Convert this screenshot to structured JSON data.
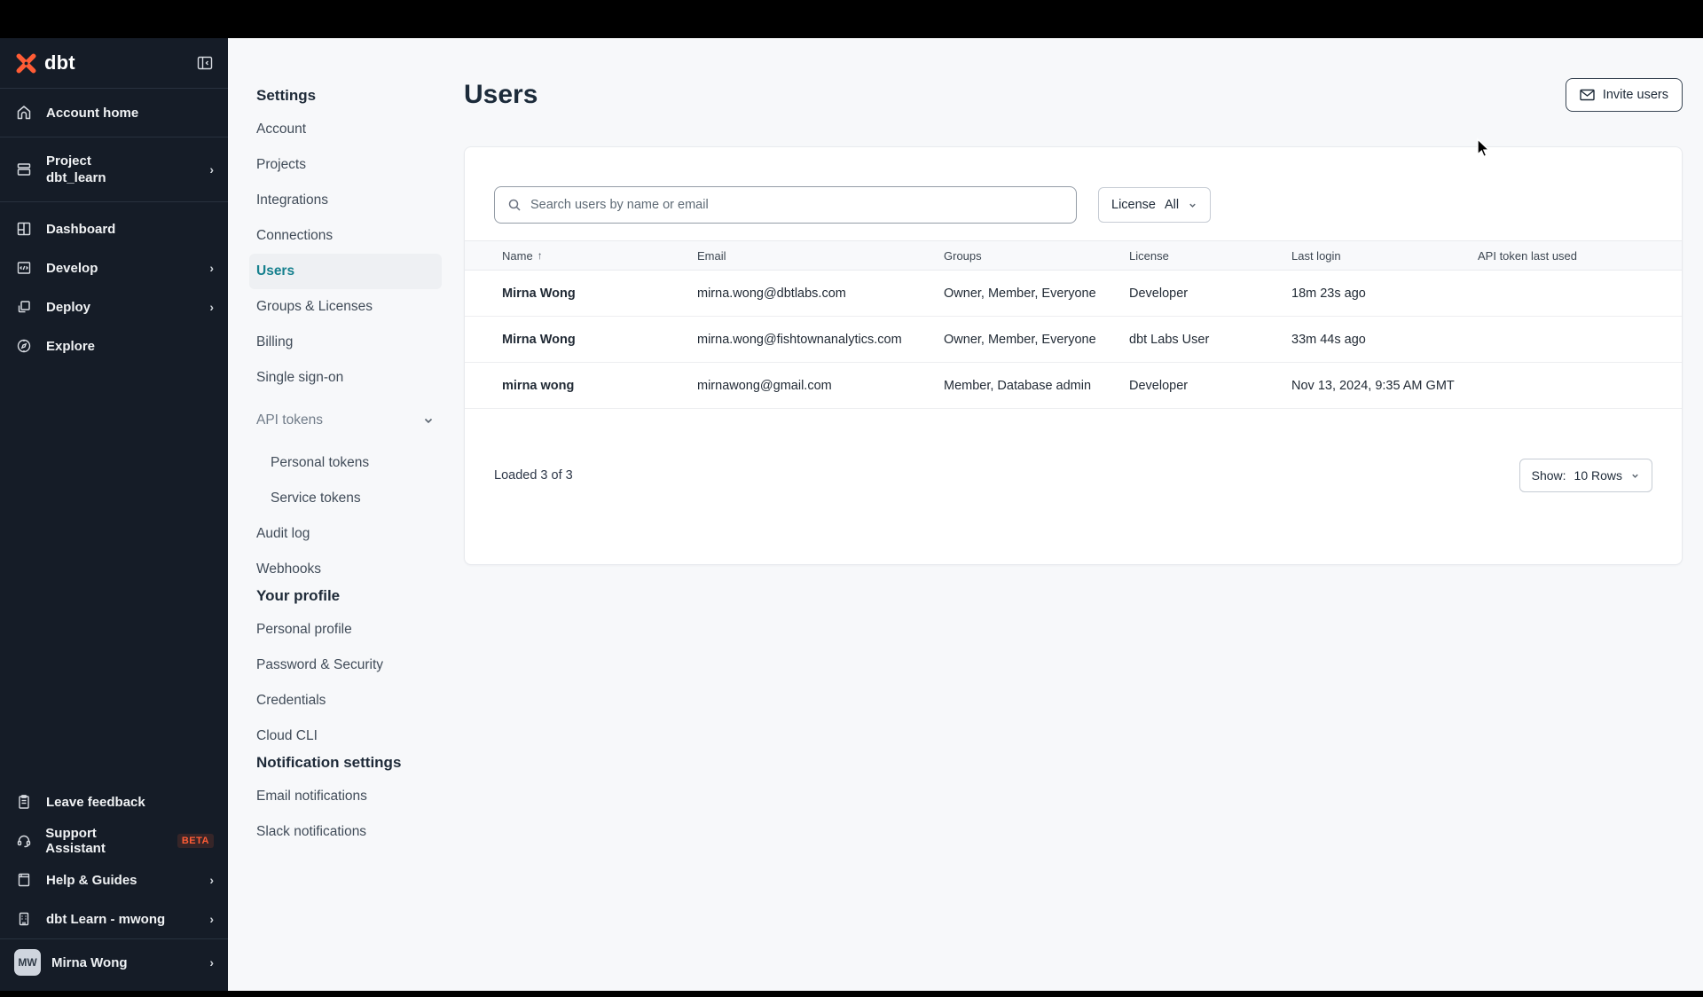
{
  "sidebar": {
    "logo_text": "dbt",
    "items": [
      {
        "label": "Account home"
      },
      {
        "label": "Project",
        "sublabel": "dbt_learn"
      },
      {
        "label": "Dashboard"
      },
      {
        "label": "Develop"
      },
      {
        "label": "Deploy"
      },
      {
        "label": "Explore"
      }
    ],
    "bottom_items": [
      {
        "label": "Leave feedback"
      },
      {
        "label": "Support Assistant",
        "badge": "BETA"
      },
      {
        "label": "Help & Guides"
      },
      {
        "label": "dbt Learn - mwong"
      }
    ],
    "user": {
      "initials": "MW",
      "name": "Mirna Wong"
    }
  },
  "settings_nav": {
    "heading": "Settings",
    "items": [
      "Account",
      "Projects",
      "Integrations",
      "Connections",
      "Users",
      "Groups & Licenses",
      "Billing",
      "Single sign-on",
      "API tokens",
      "Personal tokens",
      "Service tokens",
      "Audit log",
      "Webhooks"
    ],
    "profile_heading": "Your profile",
    "profile_items": [
      "Personal profile",
      "Password & Security",
      "Credentials",
      "Cloud CLI"
    ],
    "notifications_heading": "Notification settings",
    "notification_items": [
      "Email notifications",
      "Slack notifications"
    ]
  },
  "main": {
    "title": "Users",
    "invite_button_label": "Invite users",
    "search_placeholder": "Search users by name or email",
    "license_filter": {
      "label": "License",
      "value": "All"
    },
    "table": {
      "headers": [
        "Name",
        "Email",
        "Groups",
        "License",
        "Last login",
        "API token last used"
      ],
      "rows": [
        {
          "name": "Mirna Wong",
          "email": "mirna.wong@dbtlabs.com",
          "groups": "Owner, Member, Everyone",
          "license": "Developer",
          "last_login": "18m 23s ago",
          "api_token": ""
        },
        {
          "name": "Mirna Wong",
          "email": "mirna.wong@fishtownanalytics.com",
          "groups": "Owner, Member, Everyone",
          "license": "dbt Labs User",
          "last_login": "33m 44s ago",
          "api_token": ""
        },
        {
          "name": "mirna wong",
          "email": "mirnawong@gmail.com",
          "groups": "Member, Database admin",
          "license": "Developer",
          "last_login": "Nov 13, 2024, 9:35 AM GMT",
          "api_token": ""
        }
      ]
    },
    "footer": {
      "loaded_text": "Loaded 3 of 3",
      "show_label": "Show:",
      "show_value": "10 Rows"
    }
  },
  "colors": {
    "accent_teal": "#16808e",
    "brand_orange": "#ff5c35",
    "sidebar_bg": "#151c27"
  }
}
